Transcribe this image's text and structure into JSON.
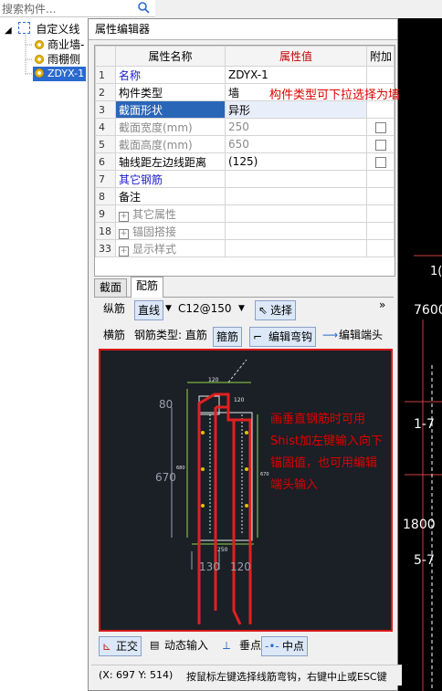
{
  "search": {
    "placeholder": "搜索构件..."
  },
  "tree": {
    "root": "自定义线",
    "items": [
      "商业墙-",
      "雨棚侧",
      "ZDYX-1"
    ]
  },
  "editor": {
    "title": "属性编辑器",
    "headers": {
      "name": "属性名称",
      "value": "属性值",
      "extra": "附加"
    },
    "rows": [
      {
        "num": "1",
        "name": "名称",
        "value": "ZDYX-1"
      },
      {
        "num": "2",
        "name": "构件类型",
        "value": "墙"
      },
      {
        "num": "3",
        "name": "截面形状",
        "value": "异形"
      },
      {
        "num": "4",
        "name": "截面宽度(mm)",
        "value": "250"
      },
      {
        "num": "5",
        "name": "截面高度(mm)",
        "value": "650"
      },
      {
        "num": "6",
        "name": "轴线距左边线距离",
        "value": "(125)"
      },
      {
        "num": "7",
        "name": "其它钢筋",
        "value": ""
      },
      {
        "num": "8",
        "name": "备注",
        "value": ""
      },
      {
        "num": "9",
        "name": "其它属性",
        "value": ""
      },
      {
        "num": "18",
        "name": "锚固搭接",
        "value": ""
      },
      {
        "num": "33",
        "name": "显示样式",
        "value": ""
      }
    ],
    "annotation_type": "构件类型可下拉选择为墙"
  },
  "tabs": [
    "截面",
    "配筋"
  ],
  "longitudinal": {
    "label": "纵筋",
    "mode": "直线",
    "spec": "C12@150",
    "select": "选择",
    "more": "»"
  },
  "transverse": {
    "label": "横筋",
    "type_label": "钢筋类型: 直筋",
    "stirrup": "箍筋",
    "edit_hook": "编辑弯钩",
    "edit_end": "编辑端头"
  },
  "drawing": {
    "dims": [
      "120",
      "120",
      "80",
      "670",
      "680",
      "670",
      "250",
      "130",
      "120"
    ],
    "annotation": "画垂直钢筋时可用\nShist加左键输入向下\n锚固值，也可用编辑\n端头输入"
  },
  "bottom_tools": [
    "正交",
    "动态输入",
    "垂点",
    "中点"
  ],
  "status": {
    "coords": "(X: 697 Y: 514)",
    "hint": "按鼠标左键选择线筋弯钩，右键中止或ESC键"
  },
  "cad_labels": [
    "1(",
    "7600",
    "1-7",
    "1800",
    "5-7"
  ]
}
